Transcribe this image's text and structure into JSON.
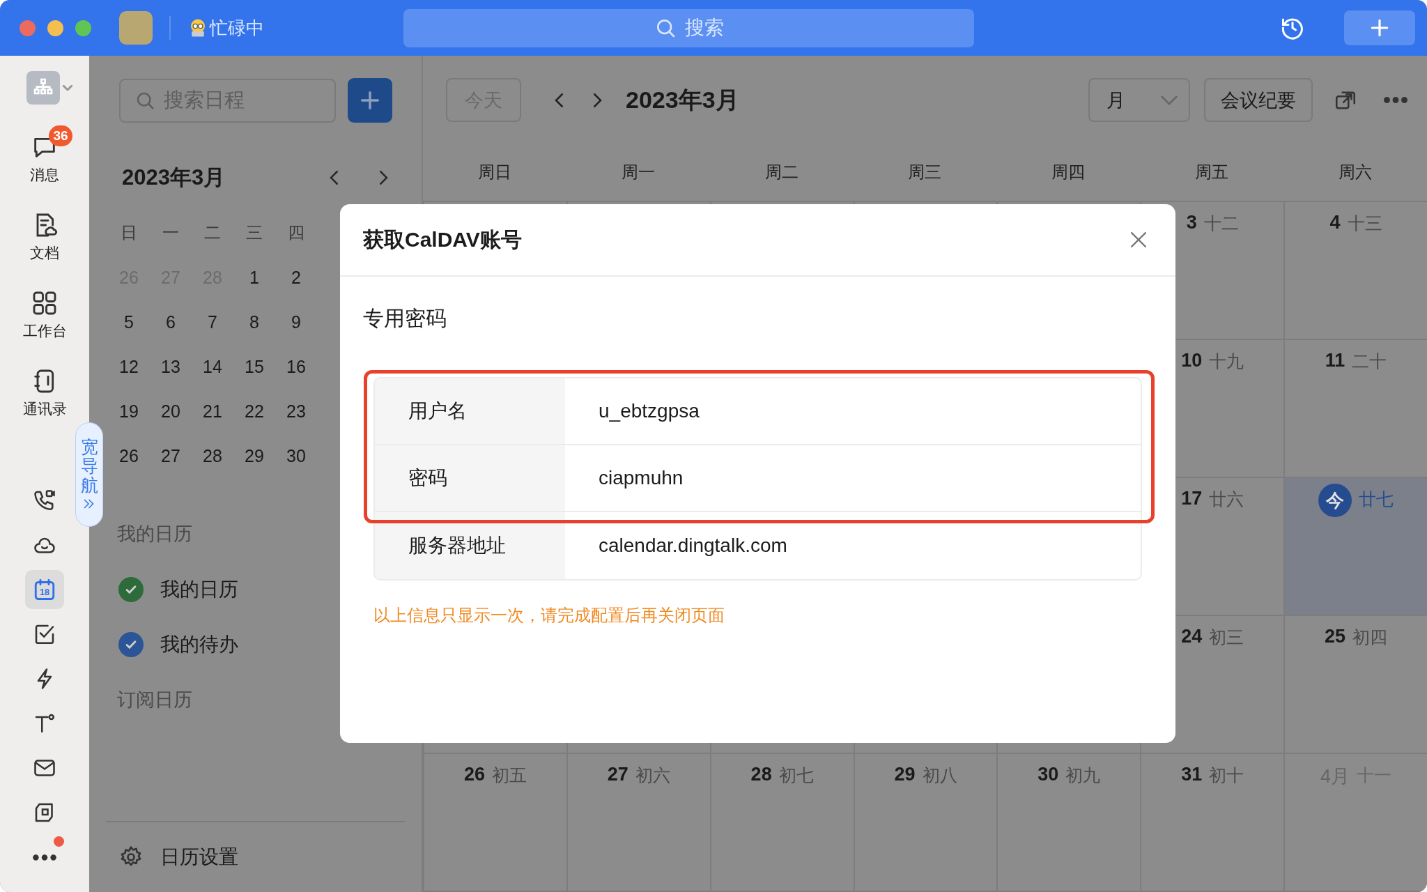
{
  "titlebar": {
    "status": "忙碌中",
    "search_placeholder": "搜索"
  },
  "rail": {
    "items": [
      {
        "kind": "org",
        "selected": false
      },
      {
        "kind": "message",
        "label": "消息",
        "badge": "36",
        "selected": false
      },
      {
        "kind": "docs",
        "label": "文档",
        "selected": false
      },
      {
        "kind": "workbench",
        "label": "工作台",
        "selected": false
      },
      {
        "kind": "contacts",
        "label": "通讯录",
        "selected": false
      },
      {
        "kind": "phone",
        "selected": false
      },
      {
        "kind": "cloud",
        "selected": false
      },
      {
        "kind": "calendar",
        "icon_text": "18",
        "selected": true
      },
      {
        "kind": "todo",
        "selected": false
      },
      {
        "kind": "bolt",
        "selected": false
      },
      {
        "kind": "text",
        "selected": false
      },
      {
        "kind": "mail",
        "selected": false
      },
      {
        "kind": "pages",
        "selected": false
      },
      {
        "kind": "more",
        "dot": true,
        "selected": false
      }
    ],
    "wide_nav": "宽导航"
  },
  "sidebar": {
    "search_placeholder": "搜索日程",
    "month_title": "2023年3月",
    "weekdays": [
      "日",
      "一",
      "二",
      "三",
      "四"
    ],
    "weeks": [
      [
        {
          "day": "26",
          "other_month": true
        },
        {
          "day": "27",
          "other_month": true
        },
        {
          "day": "28",
          "other_month": true
        },
        {
          "day": "1",
          "other_month": false
        },
        {
          "day": "2",
          "other_month": false
        }
      ],
      [
        {
          "day": "5",
          "other_month": false
        },
        {
          "day": "6",
          "other_month": false
        },
        {
          "day": "7",
          "other_month": false
        },
        {
          "day": "8",
          "other_month": false
        },
        {
          "day": "9",
          "other_month": false
        }
      ],
      [
        {
          "day": "12",
          "other_month": false
        },
        {
          "day": "13",
          "other_month": false
        },
        {
          "day": "14",
          "other_month": false
        },
        {
          "day": "15",
          "other_month": false
        },
        {
          "day": "16",
          "other_month": false
        }
      ],
      [
        {
          "day": "19",
          "other_month": false
        },
        {
          "day": "20",
          "other_month": false
        },
        {
          "day": "21",
          "other_month": false
        },
        {
          "day": "22",
          "other_month": false
        },
        {
          "day": "23",
          "other_month": false
        }
      ],
      [
        {
          "day": "26",
          "other_month": false
        },
        {
          "day": "27",
          "other_month": false
        },
        {
          "day": "28",
          "other_month": false
        },
        {
          "day": "29",
          "other_month": false
        },
        {
          "day": "30",
          "other_month": false
        }
      ]
    ],
    "sections": [
      {
        "title": "我的日历",
        "calendars": [
          {
            "name": "我的日历",
            "color": "#2e6b3a",
            "checked": true
          },
          {
            "name": "我的待办",
            "color": "#2b5596",
            "checked": true
          }
        ]
      },
      {
        "title": "订阅日历"
      }
    ],
    "settings_label": "日历设置"
  },
  "main": {
    "today_button": "今天",
    "title": "2023年3月",
    "view": "月",
    "minutes_button": "会议纪要",
    "weekdays": [
      "周日",
      "周一",
      "周二",
      "周三",
      "周四",
      "周五",
      "周六"
    ],
    "weeks": [
      {
        "cells": [
          {
            "day": "3",
            "lunar": "十二",
            "today": false,
            "other_month": false
          },
          {
            "day": "4",
            "lunar": "十三",
            "today": false,
            "other_month": false
          }
        ]
      },
      {
        "cells": [
          {
            "day": "10",
            "lunar": "十九",
            "today": false,
            "other_month": false
          },
          {
            "day": "11",
            "lunar": "二十",
            "today": false,
            "other_month": false
          }
        ]
      },
      {
        "cells": [
          {
            "day": "17",
            "lunar": "廿六",
            "today": false,
            "other_month": false
          },
          {
            "day": "今",
            "lunar": "廿七",
            "today": true,
            "other_month": false
          }
        ]
      },
      {
        "cells": [
          {
            "day": "24",
            "lunar": "初三",
            "today": false,
            "other_month": false
          },
          {
            "day": "25",
            "lunar": "初四",
            "today": false,
            "other_month": false
          }
        ]
      },
      {
        "cells": [
          {
            "day": "26",
            "lunar": "初五",
            "today": false,
            "other_month": false
          },
          {
            "day": "27",
            "lunar": "初六",
            "today": false,
            "other_month": false
          },
          {
            "day": "28",
            "lunar": "初七",
            "today": false,
            "other_month": false
          },
          {
            "day": "29",
            "lunar": "初八",
            "today": false,
            "other_month": false
          },
          {
            "day": "30",
            "lunar": "初九",
            "today": false,
            "other_month": false
          },
          {
            "day": "31",
            "lunar": "初十",
            "today": false,
            "other_month": false
          },
          {
            "day": "4月",
            "lunar": "十一",
            "today": false,
            "other_month": true
          }
        ]
      }
    ]
  },
  "dialog": {
    "title": "获取CalDAV账号",
    "section": "专用密码",
    "rows": [
      {
        "label": "用户名",
        "value": "u_ebtzgpsa",
        "highlighted": true
      },
      {
        "label": "密码",
        "value": "ciapmuhn",
        "highlighted": true
      },
      {
        "label": "服务器地址",
        "value": "calendar.dingtalk.com",
        "highlighted": false
      }
    ],
    "notice": "以上信息只显示一次，请完成配置后再关闭页面"
  }
}
